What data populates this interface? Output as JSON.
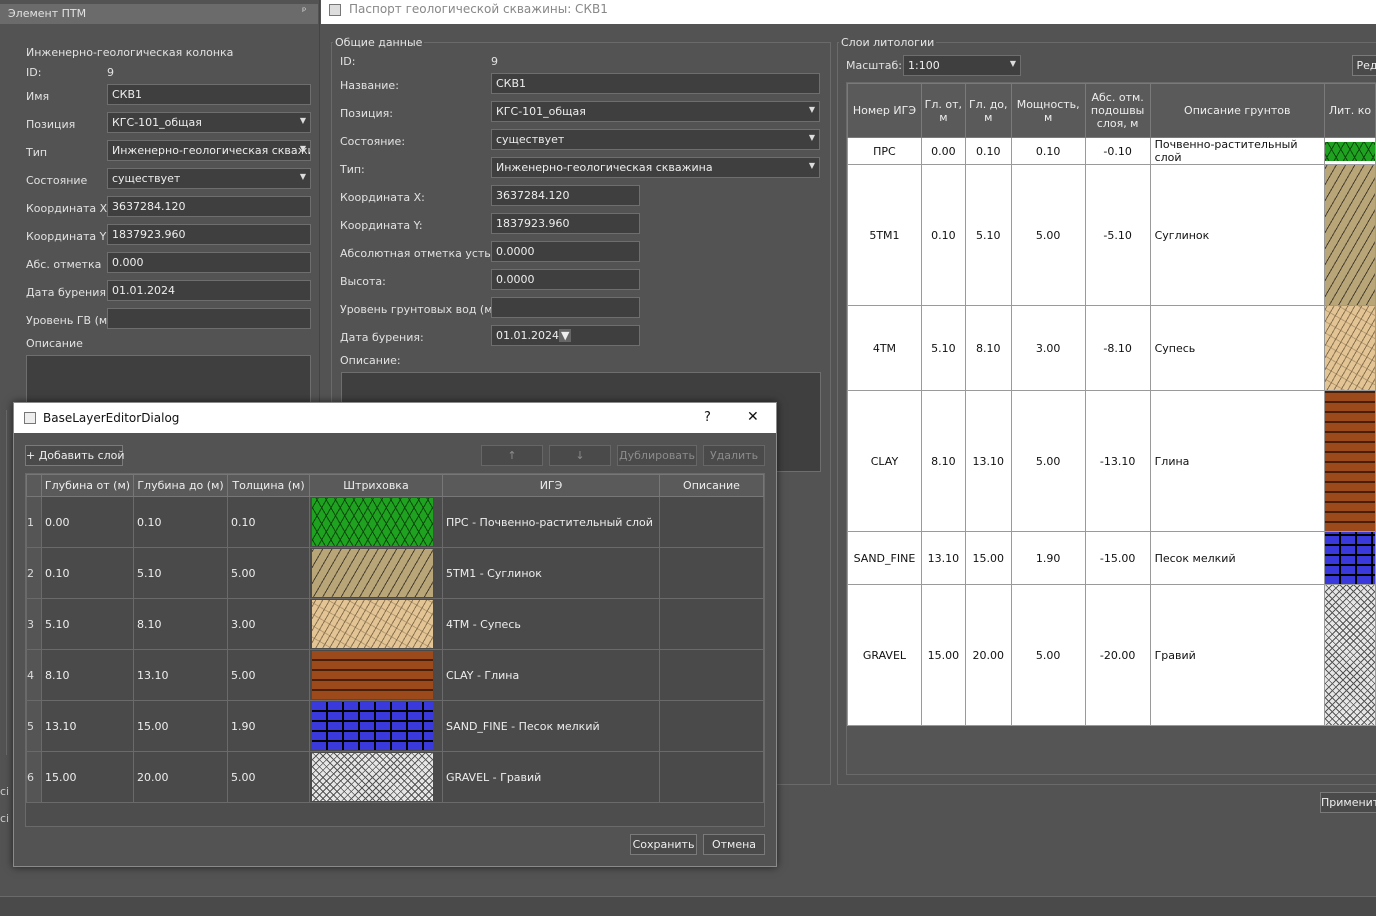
{
  "left_panel": {
    "title": "Элемент ПТМ",
    "section": "Инженерно-геологическая колонка",
    "id_label": "ID:",
    "id_value": "9",
    "fields": [
      {
        "label": "Имя",
        "value": "СКВ1",
        "combo": false
      },
      {
        "label": "Позиция",
        "value": "КГС-101_общая",
        "combo": true
      },
      {
        "label": "Тип",
        "value": "Инженерно-геологическая скважин",
        "combo": true
      },
      {
        "label": "Состояние",
        "value": "существует",
        "combo": true
      },
      {
        "label": "Координата X",
        "value": "3637284.120",
        "combo": false
      },
      {
        "label": "Координата Y",
        "value": "1837923.960",
        "combo": false
      },
      {
        "label": "Абс. отметка",
        "value": "0.000",
        "combo": false
      },
      {
        "label": "Дата бурения",
        "value": "01.01.2024",
        "combo": false
      },
      {
        "label": "Уровень ГВ (м)",
        "value": "",
        "combo": false
      }
    ],
    "desc_label": "Описание"
  },
  "passport": {
    "title": "Паспорт геологической скважины: СКВ1",
    "general_title": "Общие данные",
    "id_label": "ID:",
    "id_value": "9",
    "fields": [
      {
        "label": "Название:",
        "value": "СКВ1",
        "combo": false
      },
      {
        "label": "Позиция:",
        "value": "КГС-101_общая",
        "combo": true
      },
      {
        "label": "Состояние:",
        "value": "существует",
        "combo": true
      },
      {
        "label": "Тип:",
        "value": "Инженерно-геологическая скважина",
        "combo": true
      },
      {
        "label": "Координата X:",
        "value": "3637284.120",
        "combo": false
      },
      {
        "label": "Координата Y:",
        "value": "1837923.960",
        "combo": false
      },
      {
        "label": "Абсолютная отметка устья:",
        "value": "0.0000",
        "combo": false
      },
      {
        "label": "Высота:",
        "value": "0.0000",
        "combo": false
      },
      {
        "label": "Уровень грунтовых вод (м):",
        "value": "",
        "combo": false
      },
      {
        "label": "Дата бурения:",
        "value": "01.01.2024",
        "combo": false
      }
    ],
    "desc_label": "Описание:"
  },
  "litology": {
    "title": "Слои литологии",
    "scale_label": "Масштаб:",
    "scale_value": "1:100",
    "edit_button": "Ред",
    "apply_button": "Применит",
    "headers": [
      "Номер ИГЭ",
      "Гл. от, м",
      "Гл. до, м",
      "Мощность, м",
      "Абс. отм. подошвы слоя, м",
      "Описание грунтов",
      "Лит. ко"
    ],
    "rows": [
      {
        "ige": "ПРС",
        "from": "0.00",
        "to": "0.10",
        "thick": "0.10",
        "abs": "-0.10",
        "desc": "Почвенно-растительный слой",
        "pattern": "prs"
      },
      {
        "ige": "5ТМ1",
        "from": "0.10",
        "to": "5.10",
        "thick": "5.00",
        "abs": "-5.10",
        "desc": "Суглинок",
        "pattern": "sugl"
      },
      {
        "ige": "4ТМ",
        "from": "5.10",
        "to": "8.10",
        "thick": "3.00",
        "abs": "-8.10",
        "desc": "Супесь",
        "pattern": "supes"
      },
      {
        "ige": "CLAY",
        "from": "8.10",
        "to": "13.10",
        "thick": "5.00",
        "abs": "-13.10",
        "desc": "Глина",
        "pattern": "clay"
      },
      {
        "ige": "SAND_FINE",
        "from": "13.10",
        "to": "15.00",
        "thick": "1.90",
        "abs": "-15.00",
        "desc": "Песок мелкий",
        "pattern": "sand"
      },
      {
        "ige": "GRAVEL",
        "from": "15.00",
        "to": "20.00",
        "thick": "5.00",
        "abs": "-20.00",
        "desc": "Гравий",
        "pattern": "gravel"
      }
    ]
  },
  "dialog": {
    "title": "BaseLayerEditorDialog",
    "help": "?",
    "close": "✕",
    "add_button": "+ Добавить слой",
    "up_button": "↑",
    "down_button": "↓",
    "duplicate_button": "Дублировать",
    "delete_button": "Удалить",
    "headers": [
      "Глубина от (м)",
      "Глубина до (м)",
      "Толщина (м)",
      "Штриховка",
      "ИГЭ",
      "Описание"
    ],
    "rows": [
      {
        "n": "1",
        "from": "0.00",
        "to": "0.10",
        "thick": "0.10",
        "pattern": "prs",
        "ige": "ПРС - Почвенно-растительный слой",
        "desc": ""
      },
      {
        "n": "2",
        "from": "0.10",
        "to": "5.10",
        "thick": "5.00",
        "pattern": "sugl",
        "ige": "5ТМ1 - Суглинок",
        "desc": ""
      },
      {
        "n": "3",
        "from": "5.10",
        "to": "8.10",
        "thick": "3.00",
        "pattern": "supes",
        "ige": "4ТМ - Супесь",
        "desc": ""
      },
      {
        "n": "4",
        "from": "8.10",
        "to": "13.10",
        "thick": "5.00",
        "pattern": "clay",
        "ige": "CLAY - Глина",
        "desc": ""
      },
      {
        "n": "5",
        "from": "13.10",
        "to": "15.00",
        "thick": "1.90",
        "pattern": "sand",
        "ige": "SAND_FINE - Песок мелкий",
        "desc": ""
      },
      {
        "n": "6",
        "from": "15.00",
        "to": "20.00",
        "thick": "5.00",
        "pattern": "gravel",
        "ige": "GRAVEL - Гравий",
        "desc": ""
      }
    ],
    "save_button": "Сохранить",
    "cancel_button": "Отмена"
  },
  "colors": {
    "bg": "#535353",
    "field": "#3f3f3f",
    "title_bar": "#6b6b6b"
  }
}
